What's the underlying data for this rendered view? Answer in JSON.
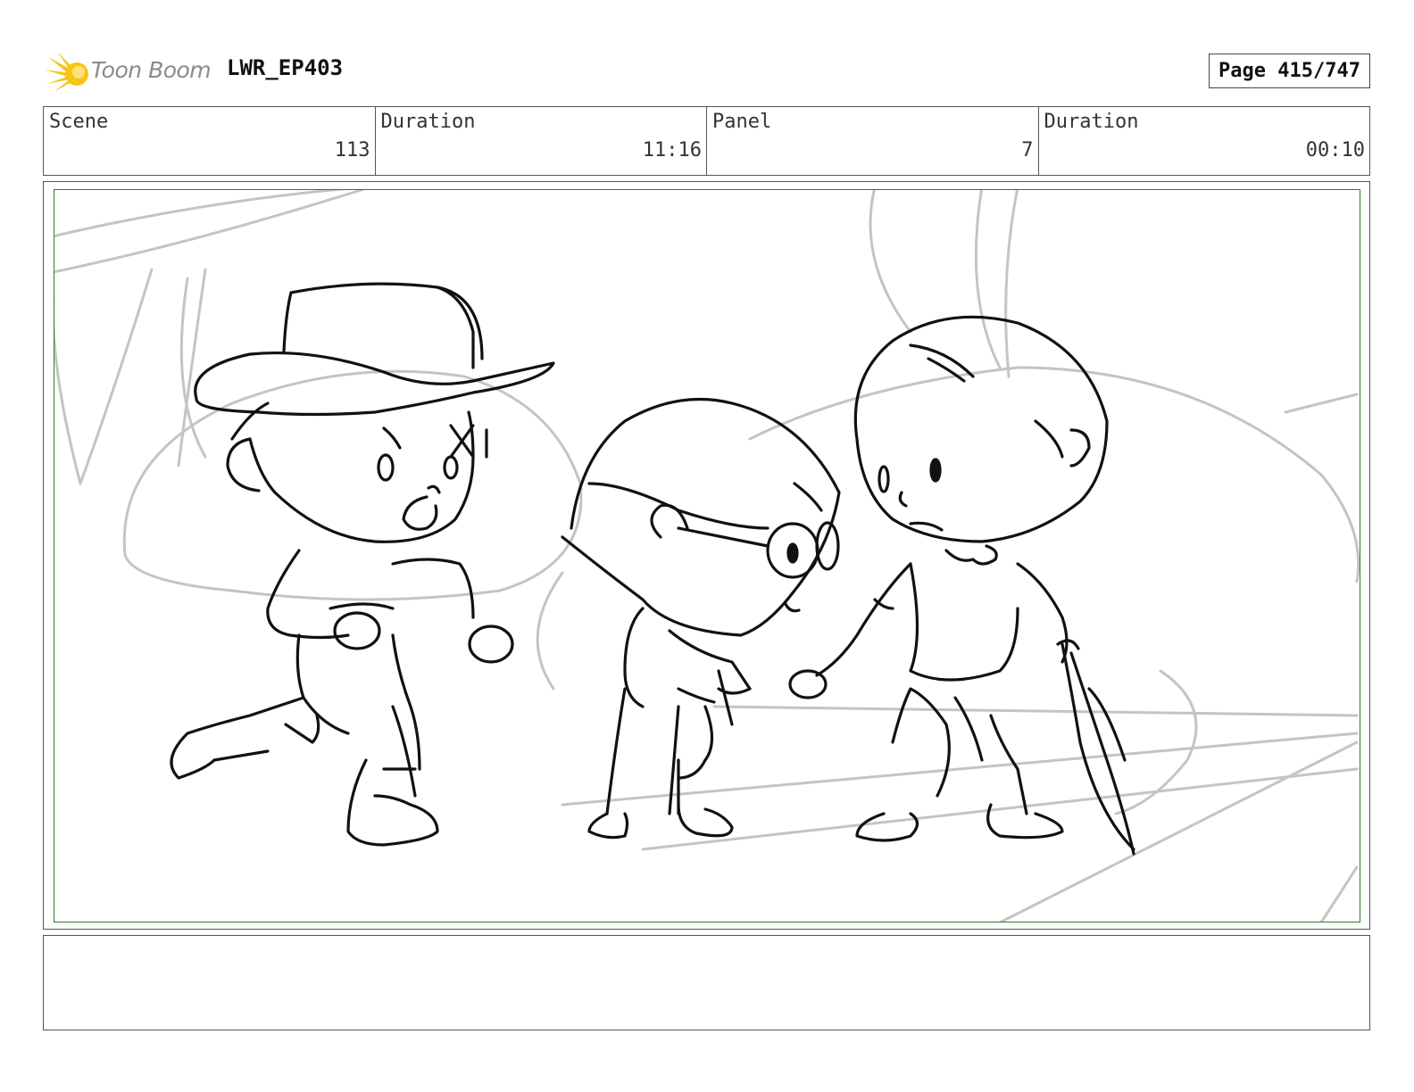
{
  "header": {
    "logo_text": "Toon Boom",
    "project": "LWR_EP403",
    "page_label": "Page 415/747"
  },
  "info": [
    {
      "label": "Scene",
      "value": "113"
    },
    {
      "label": "Duration",
      "value": "11:16"
    },
    {
      "label": "Panel",
      "value": "7"
    },
    {
      "label": "Duration",
      "value": "00:10"
    }
  ],
  "panel": {
    "drawing": "storyboard-sketch"
  },
  "notes": {
    "text": ""
  },
  "colors": {
    "safe_frame": "#2e7d32",
    "logo_yellow": "#f5c518",
    "ink": "#111111",
    "rough": "#bdbdbd"
  }
}
